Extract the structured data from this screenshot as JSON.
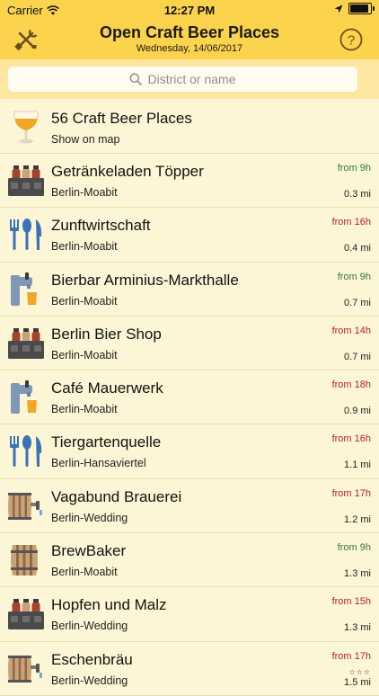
{
  "status_bar": {
    "carrier": "Carrier",
    "time": "12:27 PM"
  },
  "nav": {
    "title": "Open Craft Beer Places",
    "subtitle": "Wednesday, 14/06/2017",
    "left_icon": "tools-icon",
    "right_icon": "help-icon",
    "help_glyph": "?"
  },
  "search": {
    "placeholder": "District or name"
  },
  "map_row": {
    "title": "56 Craft Beer Places",
    "action": "Show on map"
  },
  "colors": {
    "accent": "#fcd34d",
    "open": "#2e7d32",
    "closed": "#b3261e"
  },
  "places": [
    {
      "name": "Getränkeladen Töpper",
      "district": "Berlin-Moabit",
      "hours": "from 9h",
      "status": "open",
      "distance": "0.3 mi",
      "stars": "",
      "icon": "bottle-crate"
    },
    {
      "name": "Zunftwirtschaft",
      "district": "Berlin-Moabit",
      "hours": "from 16h",
      "status": "closed",
      "distance": "0.4 mi",
      "stars": "",
      "icon": "cutlery"
    },
    {
      "name": "Bierbar Arminius-Markthalle",
      "district": "Berlin-Moabit",
      "hours": "from 9h",
      "status": "open",
      "distance": "0.7 mi",
      "stars": "",
      "icon": "beer-tap"
    },
    {
      "name": "Berlin Bier Shop",
      "district": "Berlin-Moabit",
      "hours": "from 14h",
      "status": "closed",
      "distance": "0.7 mi",
      "stars": "",
      "icon": "bottle-crate"
    },
    {
      "name": "Café Mauerwerk",
      "district": "Berlin-Moabit",
      "hours": "from 18h",
      "status": "closed",
      "distance": "0.9 mi",
      "stars": "",
      "icon": "beer-tap"
    },
    {
      "name": "Tiergartenquelle",
      "district": "Berlin-Hansaviertel",
      "hours": "from 16h",
      "status": "closed",
      "distance": "1.1 mi",
      "stars": "",
      "icon": "cutlery"
    },
    {
      "name": "Vagabund Brauerei",
      "district": "Berlin-Wedding",
      "hours": "from 17h",
      "status": "closed",
      "distance": "1.2 mi",
      "stars": "",
      "icon": "barrel-tap"
    },
    {
      "name": "BrewBaker",
      "district": "Berlin-Moabit",
      "hours": "from 9h",
      "status": "open",
      "distance": "1.3 mi",
      "stars": "",
      "icon": "barrel"
    },
    {
      "name": "Hopfen und Malz",
      "district": "Berlin-Wedding",
      "hours": "from 15h",
      "status": "closed",
      "distance": "1.3 mi",
      "stars": "",
      "icon": "bottle-crate"
    },
    {
      "name": "Eschenbräu",
      "district": "Berlin-Wedding",
      "hours": "from 17h",
      "status": "closed",
      "distance": "1.5 mi",
      "stars": "☆☆☆",
      "icon": "barrel-tap"
    }
  ]
}
